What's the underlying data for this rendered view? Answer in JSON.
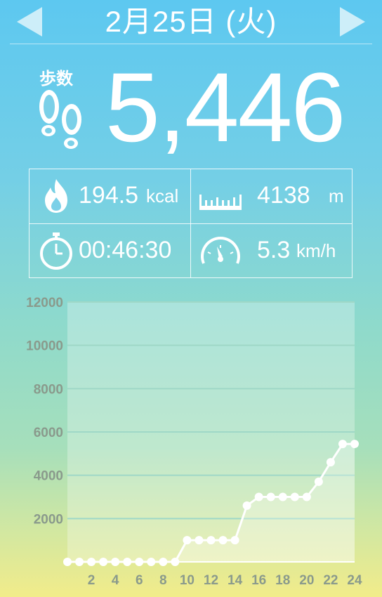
{
  "header": {
    "date_title": "2月25日 (火)",
    "prev_icon": "triangle-left-icon",
    "next_icon": "triangle-right-icon"
  },
  "steps": {
    "label": "歩数",
    "value": "5,446",
    "icon": "footprints-icon"
  },
  "stats": {
    "calories": {
      "value": "194.5",
      "unit": "kcal",
      "icon": "flame-icon"
    },
    "distance": {
      "value": "4138",
      "unit": "m",
      "icon": "ruler-icon"
    },
    "duration": {
      "value": "00:46:30",
      "unit": "",
      "icon": "stopwatch-icon"
    },
    "speed": {
      "value": "5.3",
      "unit": "km/h",
      "icon": "speedometer-icon"
    }
  },
  "colors": {
    "accent": "#ffffff",
    "axis_label": "#8a9a8c",
    "gridline": "#9fd8c7"
  },
  "chart_data": {
    "type": "line",
    "x": [
      0,
      1,
      2,
      3,
      4,
      5,
      6,
      7,
      8,
      9,
      10,
      11,
      12,
      13,
      14,
      15,
      16,
      17,
      18,
      19,
      20,
      21,
      22,
      23,
      24
    ],
    "values": [
      0,
      0,
      0,
      0,
      0,
      0,
      0,
      0,
      0,
      0,
      1000,
      1000,
      1000,
      1000,
      1000,
      2600,
      3000,
      3000,
      3000,
      3000,
      3000,
      3700,
      4600,
      5446,
      5446
    ],
    "x_tick_labels": [
      "2",
      "4",
      "6",
      "8",
      "10",
      "12",
      "14",
      "16",
      "18",
      "20",
      "22",
      "24"
    ],
    "x_ticks": [
      2,
      4,
      6,
      8,
      10,
      12,
      14,
      16,
      18,
      20,
      22,
      24
    ],
    "y_tick_labels": [
      "2000",
      "4000",
      "6000",
      "8000",
      "10000",
      "12000"
    ],
    "y_ticks": [
      2000,
      4000,
      6000,
      8000,
      10000,
      12000
    ],
    "ylim": [
      0,
      12000
    ],
    "xlim": [
      0,
      24
    ],
    "grid": true
  }
}
